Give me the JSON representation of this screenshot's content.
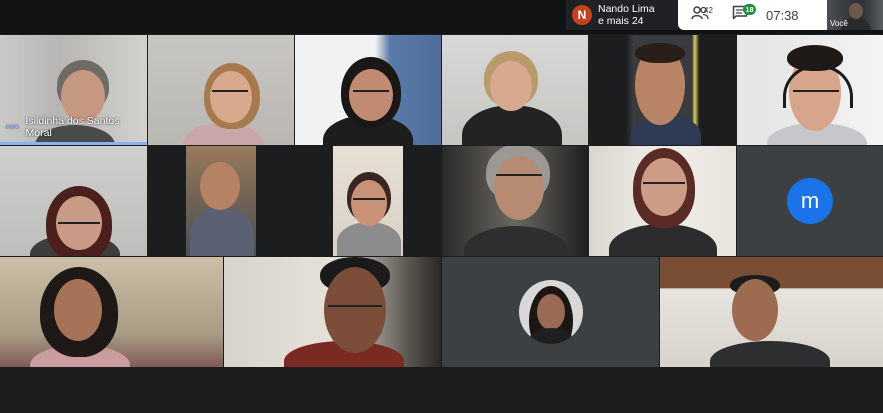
{
  "presenter": {
    "avatar_letter": "N",
    "name": "Nando Lima",
    "others": "e mais 24",
    "avatar_color": "#c5421c"
  },
  "controls": {
    "people_icon": "people-icon",
    "people_count": "42",
    "chat_icon": "chat-icon",
    "chat_count": "18",
    "time": "07:38"
  },
  "self_view": {
    "label": "Você"
  },
  "participants": {
    "isildinha": {
      "name": "Isildinha dos Santos Moral",
      "speaking": true
    },
    "placeholder_m": {
      "letter": "m",
      "color": "#1a73e8"
    }
  },
  "colors": {
    "accent_blue": "#8ab4f8",
    "background": "#1c1d1f",
    "chat_badge": "#1e8e3e"
  }
}
